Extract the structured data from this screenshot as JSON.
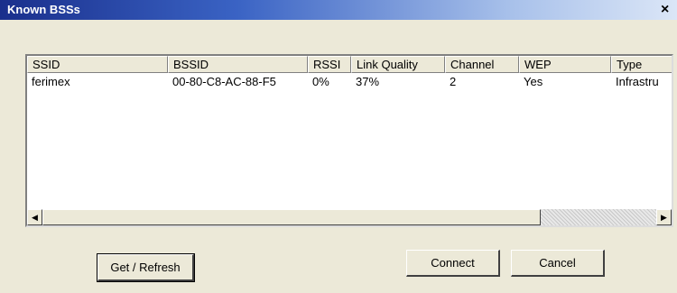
{
  "window": {
    "title": "Known BSSs",
    "close_label": "×"
  },
  "table": {
    "columns": [
      "SSID",
      "BSSID",
      "RSSI",
      "Link Quality",
      "Channel",
      "WEP",
      "Type"
    ],
    "rows": [
      [
        "ferimex",
        "00-80-C8-AC-88-F5",
        "0%",
        "37%",
        "2",
        "Yes",
        "Infrastru"
      ]
    ]
  },
  "scrollbar": {
    "left_arrow": "◀",
    "right_arrow": "▶"
  },
  "buttons": {
    "refresh_label": "Get / Refresh",
    "connect_label": "Connect",
    "cancel_label": "Cancel"
  }
}
